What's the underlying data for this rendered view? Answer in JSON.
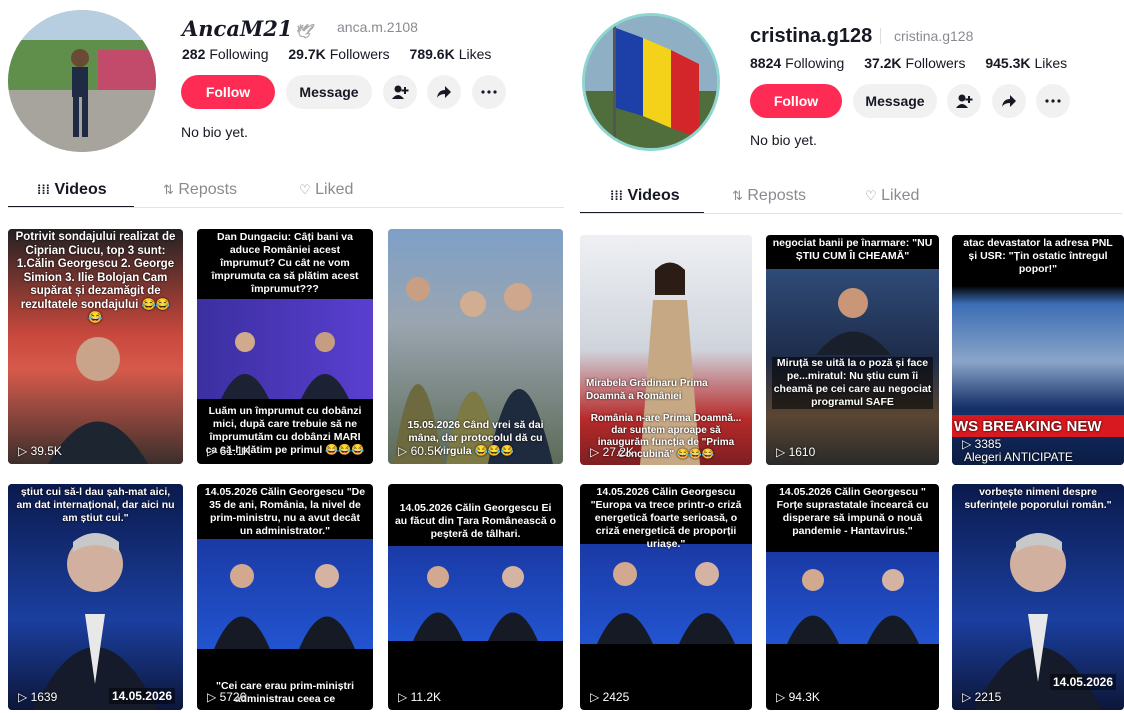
{
  "left_profile": {
    "username": "AncaM21",
    "emoji": "🕊",
    "handle": "anca.m.2108",
    "following_count": "282",
    "following_label": "Following",
    "followers_count": "29.7K",
    "followers_label": "Followers",
    "likes_count": "789.6K",
    "likes_label": "Likes",
    "follow_label": "Follow",
    "message_label": "Message",
    "bio": "No bio yet.",
    "tabs": [
      {
        "label": "Videos",
        "icon": "grid-icon"
      },
      {
        "label": "Reposts",
        "icon": "repost-icon"
      },
      {
        "label": "Liked",
        "icon": "heart-icon"
      }
    ],
    "videos": [
      {
        "caption": "Potrivit sondajului realizat de Ciprian Ciucu, top 3 sunt: 1.Călin Georgescu 2. George Simion 3. Ilie Bolojan Cam supărat și dezamăgit de rezultatele sondajului 😂😂😂",
        "views": "39.5K"
      },
      {
        "caption": "Dan Dungaciu: Câți bani va aduce României acest împrumut? Cu cât ne vom împrumuta ca să plătim acest împrumut???",
        "caption2": "Luăm un împrumut cu dobânzi mici, după care trebuie să ne împrumutăm cu dobânzi MARI ca să-l plătim pe primul 😂😂😂",
        "views": "61.1K"
      },
      {
        "caption": "15.05.2026 Când vrei să dai mâna, dar protocolul dă cu virgula 😂😂😂",
        "views": "60.5K"
      },
      {
        "caption": "știut cui să-l dau șah-mat aici, am dat internațional, dar aici nu am știut cui.\"",
        "views": "1639",
        "date": "14.05.2026"
      },
      {
        "caption": "14.05.2026 Călin Georgescu \"De 35 de ani, România, la nivel de prim-ministru, nu a avut decât un administrator.\"",
        "caption2": "\"Cei care erau prim-miniștri administrau ceea ce",
        "views": "5726"
      },
      {
        "caption": "14.05.2026 Călin Georgescu Ei au făcut din Țara Românească o peșteră de tâlhari.",
        "views": "11.2K"
      }
    ]
  },
  "right_profile": {
    "username": "cristina.g128",
    "handle": "cristina.g128",
    "following_count": "8824",
    "following_label": "Following",
    "followers_count": "37.2K",
    "followers_label": "Followers",
    "likes_count": "945.3K",
    "likes_label": "Likes",
    "follow_label": "Follow",
    "message_label": "Message",
    "bio": "No bio yet.",
    "tabs": [
      {
        "label": "Videos",
        "icon": "grid-icon"
      },
      {
        "label": "Reposts",
        "icon": "repost-icon"
      },
      {
        "label": "Liked",
        "icon": "heart-icon"
      }
    ],
    "videos": [
      {
        "caption": "Mirabela Grădinaru Prima Doamnă a României",
        "caption2": "România n-are Prima Doamnă... dar suntem aproape să inaugurăm funcția de \"Prima Concubină\" 😂😂😂",
        "views": "27.2K"
      },
      {
        "caption": "negociat banii pe înarmare: \"NU ȘTIU CUM ÎI CHEAMĂ\"",
        "caption2": "Miruță se uită la o poză și face pe...miratul: Nu știu cum îi cheamă pe cei care au negociat programul SAFE",
        "views": "1610"
      },
      {
        "caption": "atac devastator la adresa PNL și USR: \"Țin ostatic întregul popor!\"",
        "caption2": "WS BREAKING NEW",
        "caption3": "Alegeri ANTICIPATE",
        "views": "3385"
      },
      {
        "caption": "14.05.2026 Călin Georgescu \"Europa va trece printr-o criză energetică foarte serioasă, o criză energetică de proporții uriașe.\"",
        "views": "2425"
      },
      {
        "caption": "14.05.2026 Călin Georgescu \" Forțe suprastatale încearcă cu disperare să impună o nouă pandemie - Hantavirus.\"",
        "views": "94.3K"
      },
      {
        "caption": "vorbește nimeni despre suferințele poporului român.\"",
        "views": "2215",
        "date": "14.05.2026"
      }
    ]
  },
  "colors": {
    "accent": "#fe2c55",
    "text": "#161823",
    "muted": "#8a8b91",
    "button_bg": "#f1f1f2"
  }
}
